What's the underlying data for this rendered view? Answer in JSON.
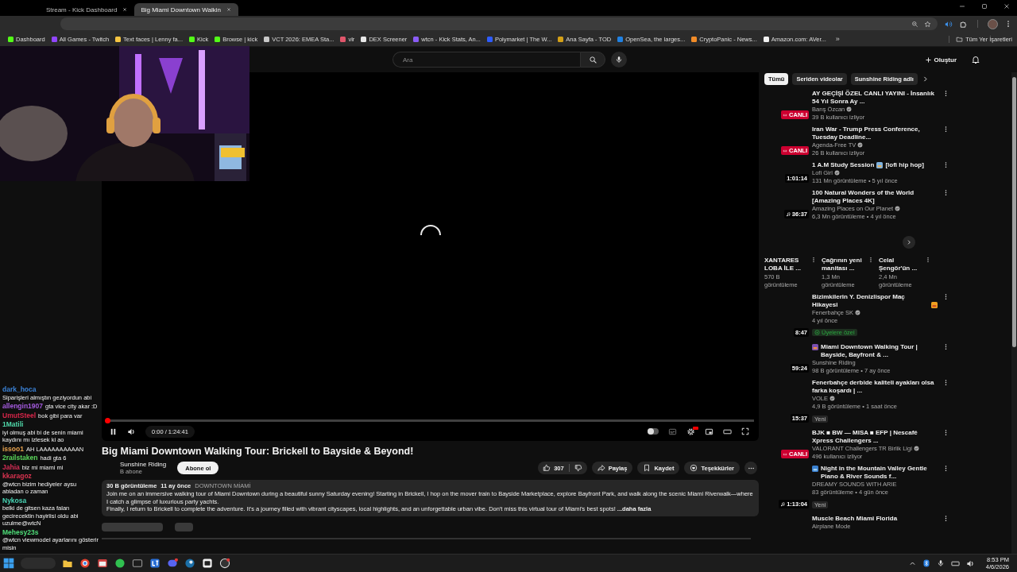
{
  "browser": {
    "tabs": [
      {
        "title": "Stream - Kick Dashboard",
        "selected": false
      },
      {
        "title": "Big Miami Downtown Walkin",
        "selected": true
      }
    ],
    "bookmarks": [
      {
        "label": "Dashboard",
        "color": "#53fc18"
      },
      {
        "label": "All Games - Twitch",
        "color": "#9146ff"
      },
      {
        "label": "Text faces | Lenny fa...",
        "color": "#f5c542"
      },
      {
        "label": "Kick",
        "color": "#53fc18"
      },
      {
        "label": "Browse | kick",
        "color": "#53fc18"
      },
      {
        "label": "VCT 2026: EMEA Sta...",
        "color": "#c9c9c9"
      },
      {
        "label": "vlr",
        "color": "#e0566b"
      },
      {
        "label": "DEX Screener",
        "color": "#e8e8e8"
      },
      {
        "label": "wtcn - Kick Stats, An...",
        "color": "#8a5cf6"
      },
      {
        "label": "Polymarket | The W...",
        "color": "#2e5cff"
      },
      {
        "label": "Ana Sayfa - TOD",
        "color": "#d4a017"
      },
      {
        "label": "OpenSea, the larges...",
        "color": "#2081e2"
      },
      {
        "label": "CryptoPanic - News...",
        "color": "#f28c28"
      },
      {
        "label": "Amazon.com: AVer...",
        "color": "#f0f0f0"
      }
    ],
    "more": "»",
    "all_bookmarks": "Tüm Yer İşaretleri"
  },
  "header": {
    "search": {
      "placeholder": "Ara"
    },
    "create": "Oluştur"
  },
  "player": {
    "level": 0,
    "time": "0:00 / 1:24:41",
    "playing": true,
    "autoplay": false,
    "hd": true,
    "loading": true
  },
  "video": {
    "title": "Big Miami Downtown Walking Tour: Brickell to Bayside & Beyond!",
    "channel": "Sunshine Riding",
    "subscribers": "B abone",
    "subscribe": "Abone ol",
    "likes": "307",
    "share": "Paylaş",
    "save": "Kaydet",
    "thanks": "Teşekkürler",
    "description": {
      "views": "30 B görüntüleme",
      "age": "11 ay önce",
      "tag": "DOWNTOWN MİAMİ",
      "lines": [
        "Join me on an immersive walking tour of Miami Downtown during a beautiful sunny Saturday evening! Starting in Brickell, I hop on the mover train to Bayside Marketplace, explore Bayfront Park, and walk along the scenic Miami Riverwalk—where I catch a glimpse of luxurious party yachts.",
        "Finally, I return to Brickell to complete the adventure. It's a journey filled with vibrant cityscapes, local highlights, and an unforgettable urban vibe. Don't miss this virtual tour of Miami's best spots!"
      ],
      "more": "...daha fazla"
    }
  },
  "sidebar": {
    "chips": [
      {
        "label": "Tümü",
        "selected": true
      },
      {
        "label": "Seriden videolar",
        "selected": false
      },
      {
        "label": "Sunshine Riding adlı",
        "selected": false
      }
    ],
    "items": [
      {
        "kind": "video",
        "title": "AY GEÇİŞİ ÖZEL CANLI YAYINI - İnsanlık 54 Yıl Sonra Ay ...",
        "channel": "Barış Özcan",
        "verified": true,
        "meta": "39 B kullanıcı izliyor",
        "badge": {
          "kind": "live",
          "text": "CANLI"
        }
      },
      {
        "kind": "video",
        "title": "Iran War - Trump Press Conference, Tuesday Deadline...",
        "channel": "Agenda-Free TV",
        "verified": true,
        "meta": "26 B kullanıcı izliyor",
        "badge": {
          "kind": "live",
          "text": "CANLI"
        }
      },
      {
        "kind": "video",
        "title": "1 A.M Study Session",
        "emoji": {
          "kind": "books"
        },
        "title_end": "[lofi hip hop]",
        "channel": "Lofi Girl",
        "verified": true,
        "meta": "131 Mn görüntüleme • 5 yıl önce",
        "badge": {
          "kind": "duration",
          "text": "1:01:14"
        }
      },
      {
        "kind": "video",
        "title": "100 Natural Wonders of the World  [Amazing Places 4K]",
        "channel": "Amazing Places on Our Planet",
        "verified": true,
        "meta": "6,3 Mn görüntüleme • 4 yıl önce",
        "badge": {
          "kind": "music",
          "text": "36:37"
        }
      },
      {
        "kind": "shelf",
        "items": [
          {
            "title": "XANTARES LOBA İLE ...",
            "views": "570 B görüntüleme"
          },
          {
            "title": "Çağrının yeni manitası ...",
            "views": "1,3 Mn görüntüleme"
          },
          {
            "title": "Celal Şengör'ün ...",
            "views": "2,4 Mn görüntüleme"
          }
        ]
      },
      {
        "kind": "video",
        "title": "Bizimkilerin Y. Denizlispor Maç Hikayesi",
        "emoji": {
          "kind": "angry"
        },
        "channel": "Fenerbahçe SK",
        "verified": true,
        "meta": "4 yıl önce",
        "tag": {
          "kind": "members",
          "text": "Üyelere özel"
        },
        "badge": {
          "kind": "duration",
          "text": "8:47"
        }
      },
      {
        "kind": "video",
        "emoji": {
          "kind": "sunset"
        },
        "title": "Miami Downtown Walking Tour | Bayside, Bayfront & ...",
        "channel": "Sunshine Riding",
        "verified": false,
        "meta": "98 B görüntüleme • 7 ay önce",
        "badge": {
          "kind": "duration",
          "text": "59:24"
        }
      },
      {
        "kind": "video",
        "title": "Fenerbahçe derbide kaliteli ayakları olsa farka koşardı | ...",
        "channel": "VOLE",
        "verified": true,
        "meta": "4,9 B görüntüleme • 1 saat önce",
        "tag": {
          "kind": "new",
          "text": "Yeni"
        },
        "badge": {
          "kind": "duration",
          "text": "15:37"
        }
      },
      {
        "kind": "video",
        "title": "BJK ■ BW — MISA ■ EFP | Nescafé Xpress Challengers ...",
        "channel": "VALORANT Challengers TR Birlik Ligi",
        "verified": true,
        "meta": "496 kullanıcı izliyor",
        "badge": {
          "kind": "live",
          "text": "CANLI"
        }
      },
      {
        "kind": "video",
        "emoji": {
          "kind": "wave"
        },
        "title": "Night in the Mountain Valley Gentle Piano & River Sounds f...",
        "channel": "DREAMY SOUNDS WITH ARIE",
        "verified": false,
        "meta": "83 görüntüleme • 4 gün önce",
        "tag": {
          "kind": "new",
          "text": "Yeni"
        },
        "badge": {
          "kind": "music",
          "text": "1:13:04"
        }
      },
      {
        "kind": "video",
        "title": "Muscle Beach Miami Florida",
        "channel": "Airplane Mode",
        "verified": false
      }
    ]
  },
  "chat": [
    {
      "user": "dark_hoca",
      "color": "#3b82d6",
      "message": "Siparişleri almıştın geziyordun abi"
    },
    {
      "user": "allengin1907",
      "color": "#a55be0",
      "message": "gta vice city akar :D"
    },
    {
      "user": "UmutSteel",
      "color": "#d8264a",
      "message": "bok gibi para var"
    },
    {
      "user": "1Matili",
      "color": "#4fd6a8",
      "message": "iyi olmuş abi bi de senin miami kaydını mı izlesek ki ao"
    },
    {
      "user": "issoo1",
      "color": "#e6a24f",
      "message": "AH LAAAAAAAAAAN"
    },
    {
      "user": "2railstaken",
      "color": "#5ad65a",
      "message": "hadi gta 6"
    },
    {
      "user": "Jahia",
      "color": "#d62d55",
      "message": "biz mi miami mi"
    },
    {
      "user": "kkaragoz",
      "color": "#d8334f",
      "message": "@wtcn bizim hediyeler aysu abladan o zaman"
    },
    {
      "user": "Nykosa",
      "color": "#48d6b6",
      "message": "belki de gitsen kaza falan gecirecektin hayirlisi oldu abi uzulme@wtcN"
    },
    {
      "user": "Mehesy23s",
      "color": "#4fdc78",
      "message": "@wtcn viewmodel ayarlarını gösterir misin"
    }
  ],
  "taskbar": {
    "time": "8:53 PM",
    "date": "4/6/2026"
  }
}
